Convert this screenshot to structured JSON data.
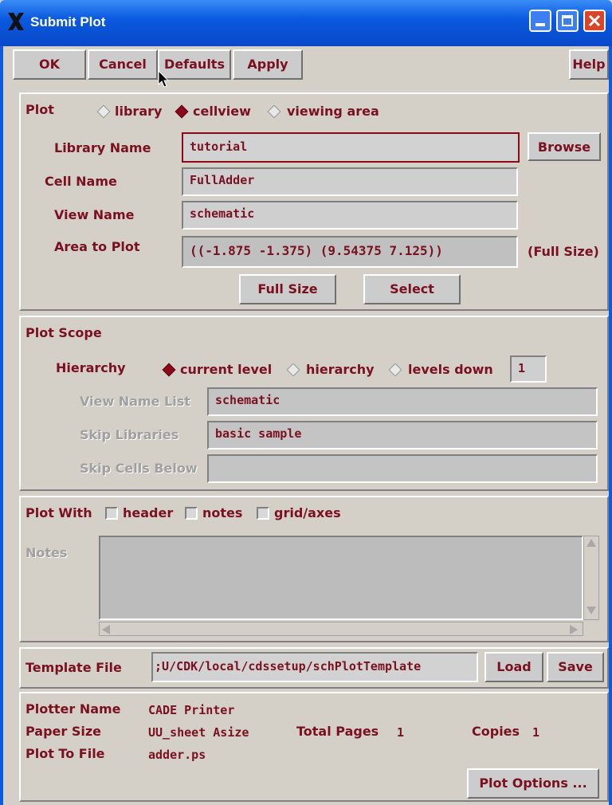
{
  "window": {
    "title": "Submit Plot"
  },
  "toolbar": {
    "ok": "OK",
    "cancel": "Cancel",
    "defaults": "Defaults",
    "apply": "Apply",
    "help": "Help"
  },
  "plot": {
    "label": "Plot",
    "options": [
      "library",
      "cellview",
      "viewing area"
    ],
    "selected": "cellview",
    "library_name_label": "Library Name",
    "library_name": "tutorial",
    "browse": "Browse",
    "cell_name_label": "Cell Name",
    "cell_name": "FullAdder",
    "view_name_label": "View Name",
    "view_name": "schematic",
    "area_label": "Area to Plot",
    "area": "((-1.875 -1.375) (9.54375 7.125))",
    "area_size": "(Full Size)",
    "full_size_button": "Full Size",
    "select_button": "Select"
  },
  "scope": {
    "label": "Plot Scope",
    "hierarchy_label": "Hierarchy",
    "options": [
      "current level",
      "hierarchy",
      "levels down"
    ],
    "selected": "current level",
    "levels": "1",
    "view_name_list_label": "View Name List",
    "view_name_list": "schematic",
    "skip_libraries_label": "Skip Libraries",
    "skip_libraries": "basic sample",
    "skip_cells_label": "Skip Cells Below",
    "skip_cells": ""
  },
  "plot_with": {
    "label": "Plot With",
    "options": [
      "header",
      "notes",
      "grid/axes"
    ],
    "notes_label": "Notes",
    "notes": ""
  },
  "template": {
    "label": "Template File",
    "value": ";U/CDK/local/cdssetup/schPlotTemplate",
    "load": "Load",
    "save": "Save"
  },
  "plotter": {
    "plotter_name_label": "Plotter Name",
    "plotter_name": "CADE Printer",
    "paper_size_label": "Paper Size",
    "paper_size": "UU_sheet Asize",
    "total_pages_label": "Total Pages",
    "total_pages": "1",
    "copies_label": "Copies",
    "copies": "1",
    "plot_to_file_label": "Plot To File",
    "plot_to_file": "adder.ps",
    "plot_options": "Plot Options ..."
  },
  "colors": {
    "label": "#7a1020",
    "titlebar": "#0b5ae0",
    "close": "#d8452a",
    "selected_diamond": "#8b0a1a"
  }
}
